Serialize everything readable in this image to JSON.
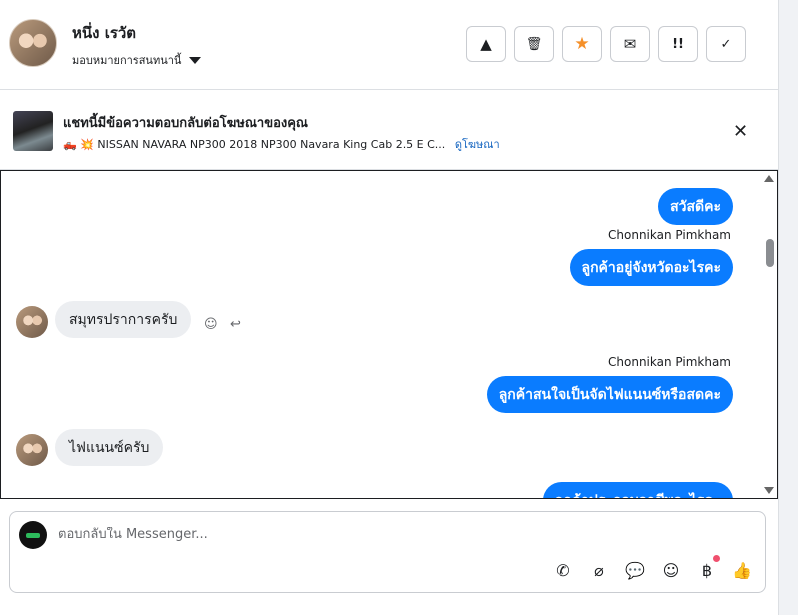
{
  "header": {
    "contact_name": "หนึ่ง เรวัต",
    "assign_label": "มอบหมายการสนทนานี้",
    "tools": [
      {
        "icon": "warning-icon",
        "glyph": "▲"
      },
      {
        "icon": "trash-icon",
        "glyph": "🗑"
      },
      {
        "icon": "star-icon",
        "glyph": "★"
      },
      {
        "icon": "envelope-icon",
        "glyph": "✉"
      },
      {
        "icon": "priority-icon",
        "glyph": "!!"
      },
      {
        "icon": "check-icon",
        "glyph": "✓"
      }
    ]
  },
  "ad": {
    "title": "แชทนี้มีข้อความตอบกลับต่อโฆษณาของคุณ",
    "subtitle": "🛻 💥 NISSAN NAVARA NP300 2018 NP300 Navara King Cab 2.5 E C...",
    "link": "ดูโฆษณา",
    "close_glyph": "✕"
  },
  "messages": [
    {
      "direction": "out",
      "text": "สวัสดีคะ"
    },
    {
      "direction": "out",
      "sender": "Chonnikan Pimkham",
      "text": "ลูกค้าอยู่จังหวัดอะไรคะ"
    },
    {
      "direction": "in",
      "text": "สมุทรปราการครับ"
    },
    {
      "direction": "out",
      "sender": "Chonnikan Pimkham",
      "text": "ลูกค้าสนใจเป็นจัดไฟแนนซ์หรือสดคะ"
    },
    {
      "direction": "in",
      "text": "ไฟแนนซ์ครับ"
    },
    {
      "direction": "out",
      "text": "ลูกค้าประกอบอาชีพอะไรคะ"
    }
  ],
  "message_actions": {
    "react_glyph": "☺",
    "reply_glyph": "↩"
  },
  "composer": {
    "placeholder": "ตอบกลับใน Messenger...",
    "tools": [
      {
        "icon": "call-add-icon",
        "glyph": "✆"
      },
      {
        "icon": "attachment-icon",
        "glyph": "⌀"
      },
      {
        "icon": "chat-bubble-icon",
        "glyph": "💬"
      },
      {
        "icon": "emoji-icon",
        "glyph": "☺"
      },
      {
        "icon": "baht-icon",
        "glyph": "฿"
      },
      {
        "icon": "thumbs-up-icon",
        "glyph": "👍"
      }
    ]
  },
  "colors": {
    "accent": "#0a7cff",
    "star": "#f5902a",
    "link": "#1565c0"
  }
}
